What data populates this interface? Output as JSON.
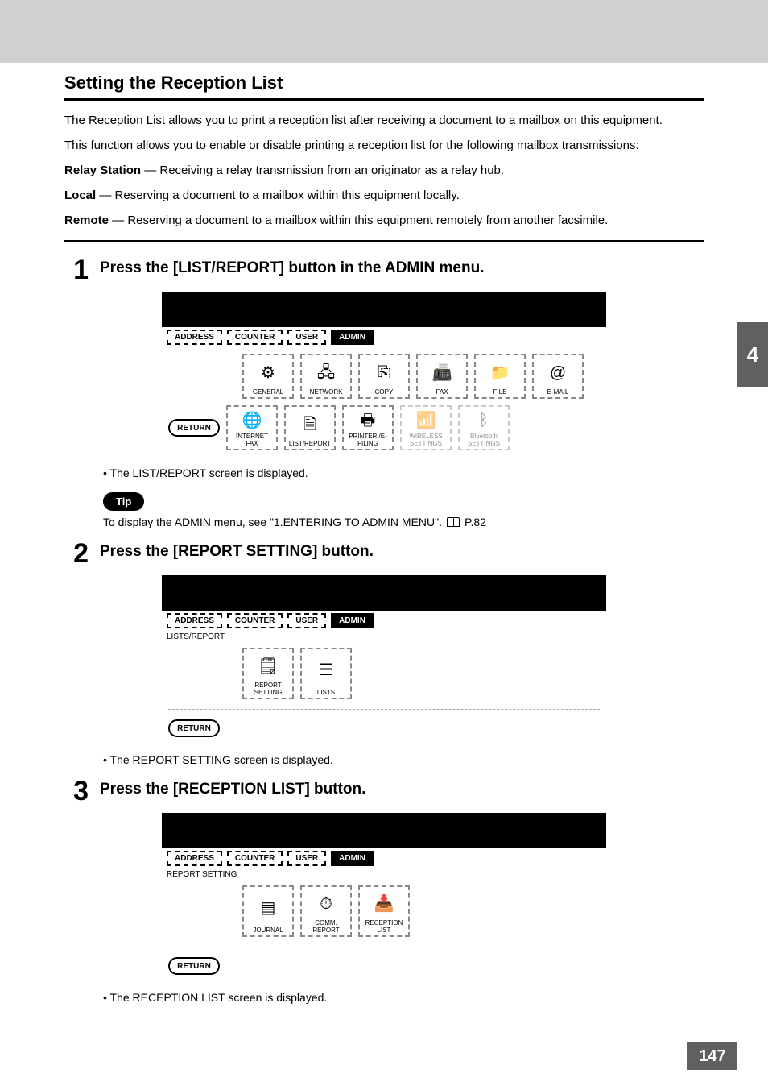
{
  "chapter_tab": "4",
  "page_number": "147",
  "section_title": "Setting the Reception List",
  "intro_para1": "The Reception List allows you to print a reception list after receiving a document to a mailbox on this equipment.",
  "intro_para2": "This function allows you to enable or disable printing a reception list for the following mailbox transmissions:",
  "defs": {
    "relay_term": "Relay Station",
    "relay_text": " — Receiving a relay transmission from an originator as a relay hub.",
    "local_term": "Local",
    "local_text": " — Reserving a document to a mailbox within this equipment locally.",
    "remote_term": "Remote",
    "remote_text": " — Reserving a document to a mailbox within this equipment remotely from another facsimile."
  },
  "steps": {
    "s1_num": "1",
    "s1_title": "Press the [LIST/REPORT] button in the ADMIN menu.",
    "s1_note": "The LIST/REPORT screen is displayed.",
    "s2_num": "2",
    "s2_title": "Press the [REPORT SETTING] button.",
    "s2_note": "The REPORT SETTING screen is displayed.",
    "s3_num": "3",
    "s3_title": "Press the [RECEPTION LIST] button.",
    "s3_note": "The RECEPTION LIST screen is displayed."
  },
  "tip": {
    "label": "Tip",
    "text": "To display the ADMIN menu, see \"1.ENTERING TO ADMIN MENU\".",
    "ref": "P.82"
  },
  "ui": {
    "tabs": {
      "address": "ADDRESS",
      "counter": "COUNTER",
      "user": "USER",
      "admin": "ADMIN"
    },
    "return": "RETURN",
    "screen1": {
      "row1": [
        "GENERAL",
        "NETWORK",
        "COPY",
        "FAX",
        "FILE",
        "E-MAIL"
      ],
      "row2": [
        "INTERNET FAX",
        "LIST/REPORT",
        "PRINTER /E-FILING",
        "WIRELESS SETTINGS",
        "Bluetooth SETTINGS"
      ]
    },
    "screen2": {
      "label": "LISTS/REPORT",
      "buttons": [
        "REPORT SETTING",
        "LISTS"
      ]
    },
    "screen3": {
      "label": "REPORT SETTING",
      "buttons": [
        "JOURNAL",
        "COMM. REPORT",
        "RECEPTION LIST"
      ]
    }
  }
}
